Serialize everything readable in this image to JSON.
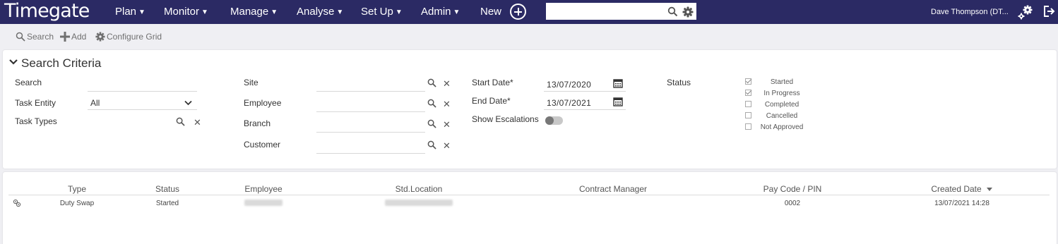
{
  "app": {
    "logo": "Timegate"
  },
  "nav": {
    "items": [
      {
        "label": "Plan"
      },
      {
        "label": "Monitor"
      },
      {
        "label": "Manage"
      },
      {
        "label": "Analyse"
      },
      {
        "label": "Set Up"
      },
      {
        "label": "Admin"
      },
      {
        "label": "New"
      }
    ],
    "search_placeholder": "",
    "user": "Dave Thompson (DT..."
  },
  "toolbar": {
    "search": "Search",
    "add": "Add",
    "configure": "Configure Grid"
  },
  "criteria": {
    "title": "Search Criteria",
    "search_label": "Search",
    "search_value": "",
    "task_entity_label": "Task Entity",
    "task_entity_value": "All",
    "task_types_label": "Task Types",
    "site_label": "Site",
    "employee_label": "Employee",
    "branch_label": "Branch",
    "customer_label": "Customer",
    "start_date_label": "Start Date*",
    "start_date_value": "13/07/2020",
    "end_date_label": "End Date*",
    "end_date_value": "13/07/2021",
    "show_escalations_label": "Show Escalations",
    "show_escalations_on": false,
    "status_label": "Status",
    "statuses": [
      {
        "label": "Started",
        "checked": true
      },
      {
        "label": "In Progress",
        "checked": true
      },
      {
        "label": "Completed",
        "checked": false
      },
      {
        "label": "Cancelled",
        "checked": false
      },
      {
        "label": "Not Approved",
        "checked": false
      }
    ]
  },
  "grid": {
    "columns": [
      "Type",
      "Status",
      "Employee",
      "Std.Location",
      "Contract Manager",
      "Pay Code / PIN",
      "Created Date"
    ],
    "sort_icon": "caret-down-icon",
    "rows": [
      {
        "icon": "duty-swap-icon",
        "type": "Duty Swap",
        "status": "Started",
        "employee": "",
        "location": "",
        "contract_manager": "",
        "pay_code": "0002",
        "created": "13/07/2021 14:28"
      }
    ]
  },
  "colors": {
    "navbar": "#2b2a64",
    "panel": "#ffffff",
    "background": "#efeff3"
  }
}
